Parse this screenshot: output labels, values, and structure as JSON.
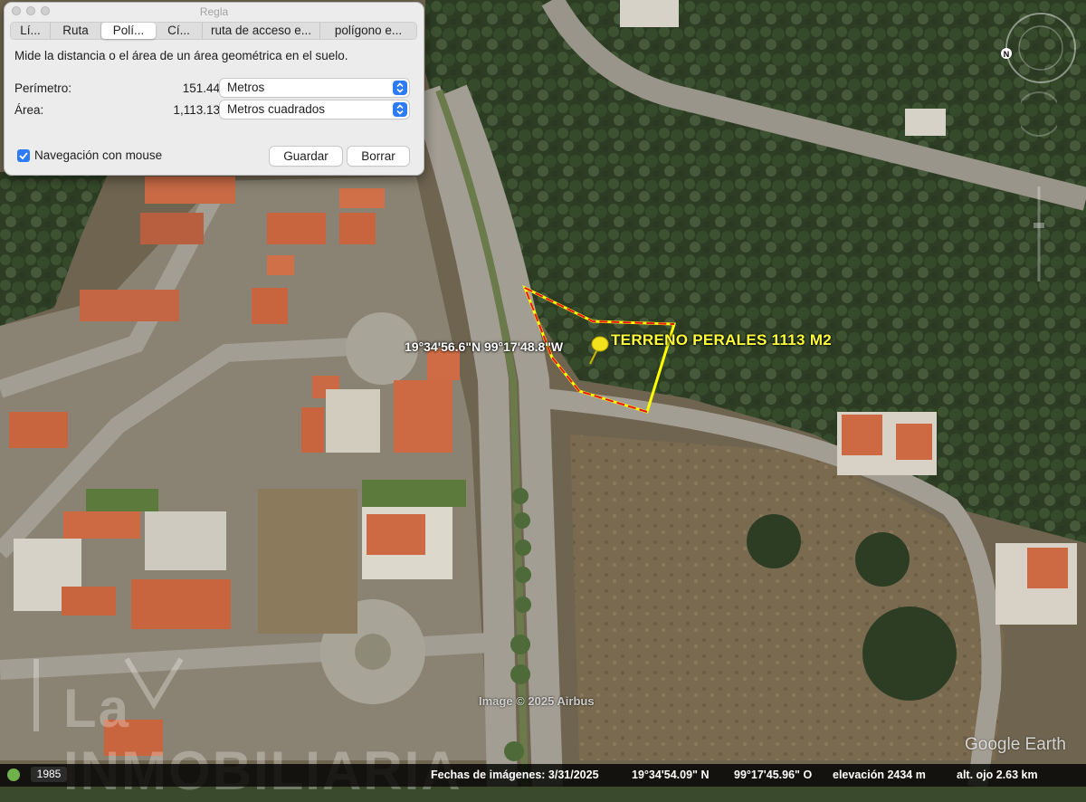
{
  "ruler": {
    "window_title": "Regla",
    "tabs": [
      {
        "label": "Lí..."
      },
      {
        "label": "Ruta"
      },
      {
        "label": "Polí..."
      },
      {
        "label": "Cí..."
      },
      {
        "label": "ruta de acceso e..."
      },
      {
        "label": "polígono e..."
      }
    ],
    "active_tab_index": 2,
    "description": "Mide la distancia o el área de un área geométrica en el suelo.",
    "perimeter": {
      "label": "Perímetro:",
      "value": "151.44",
      "unit": "Metros"
    },
    "area": {
      "label": "Área:",
      "value": "1,113.13",
      "unit": "Metros cuadrados"
    },
    "mouse_nav": {
      "label": "Navegación con mouse",
      "checked": true
    },
    "save_label": "Guardar",
    "clear_label": "Borrar"
  },
  "map": {
    "coord_label": "19°34'56.6\"N 99°17'48.8\"W",
    "placemark_label": "TERRENO PERALES 1113 M2",
    "watermark": "La INMOBILIARIA",
    "copyright": "Image © 2025 Airbus",
    "logo": "Google Earth",
    "polygon_colors": {
      "outline": "#ffff00",
      "measure": "#e8141c"
    }
  },
  "status": {
    "year": "1985",
    "imagery_date": "Fechas de imágenes: 3/31/2025",
    "lat": "19°34'54.09\" N",
    "lon": "99°17'45.96\" O",
    "elevation": "elevación 2434 m",
    "eye_alt": "alt. ojo   2.63 km"
  }
}
